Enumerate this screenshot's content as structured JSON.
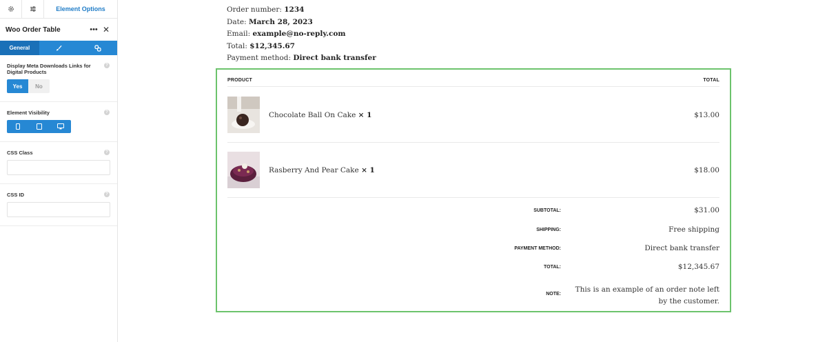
{
  "sidebar": {
    "tabs": {
      "options_label": "Element Options"
    },
    "title": "Woo Order Table",
    "subtabs": {
      "general_label": "General"
    },
    "downloads": {
      "label": "Display Meta Downloads Links for Digital Products",
      "yes": "Yes",
      "no": "No",
      "selected": "Yes"
    },
    "visibility": {
      "label": "Element Visibility",
      "devices": [
        "mobile",
        "tablet",
        "desktop"
      ]
    },
    "css_class": {
      "label": "CSS Class",
      "value": ""
    },
    "css_id": {
      "label": "CSS ID",
      "value": ""
    }
  },
  "order": {
    "number_label": "Order number:",
    "number": "1234",
    "date_label": "Date:",
    "date": "March 28, 2023",
    "email_label": "Email:",
    "email": "example@no-reply.com",
    "total_label": "Total:",
    "total": "$12,345.67",
    "payment_label": "Payment method:",
    "payment": "Direct bank transfer"
  },
  "table": {
    "headers": {
      "product": "PRODUCT",
      "total": "TOTAL"
    },
    "items": [
      {
        "name": "Chocolate Ball On Cake",
        "qty": "× 1",
        "total": "$13.00"
      },
      {
        "name": "Rasberry And Pear Cake",
        "qty": "× 1",
        "total": "$18.00"
      }
    ],
    "totals": [
      {
        "label": "SUBTOTAL:",
        "value": "$31.00"
      },
      {
        "label": "SHIPPING:",
        "value": "Free shipping"
      },
      {
        "label": "PAYMENT METHOD:",
        "value": "Direct bank transfer"
      },
      {
        "label": "TOTAL:",
        "value": "$12,345.67"
      }
    ],
    "note": {
      "label": "NOTE:",
      "value": "This is an example of an order note left by the customer."
    }
  },
  "colors": {
    "accent": "#2688d4",
    "accent_dark": "#1a70b8",
    "highlight_border": "#6cc36c"
  }
}
